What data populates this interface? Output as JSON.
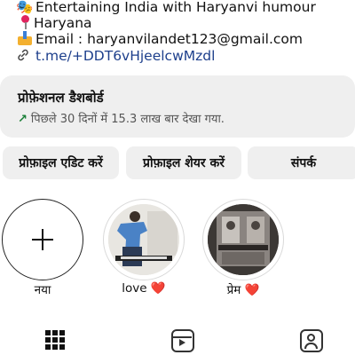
{
  "bio": {
    "line1_emoji": "🎭",
    "line1": "Entertaining India with Haryanvi humour",
    "line2": "Haryana",
    "line3": "Email : haryanvilandet123@gmail.com",
    "link": "t.me/+DDT6vHjeelcwMzdl"
  },
  "dashboard": {
    "title": "प्रोफ़ेशनल डैशबोर्ड",
    "subtitle": "पिछले 30 दिनों में 15.3 लाख बार देखा गया."
  },
  "buttons": {
    "edit_profile": "प्रोफ़ाइल एडिट करें",
    "share_profile": "प्रोफ़ाइल शेयर करें",
    "contact": "संपर्क"
  },
  "highlights": [
    {
      "label": "नया",
      "heart": ""
    },
    {
      "label": "love ",
      "heart": "❤️"
    },
    {
      "label": "प्रेम ",
      "heart": "❤️"
    }
  ],
  "nav": {
    "icons": [
      "grid-icon",
      "reels-icon",
      "tagged-icon"
    ]
  },
  "colors": {
    "link": "#1d3f8c",
    "panel": "#efefef",
    "trend_arrow": "#1a7f37",
    "heart": "#e02a2a"
  }
}
